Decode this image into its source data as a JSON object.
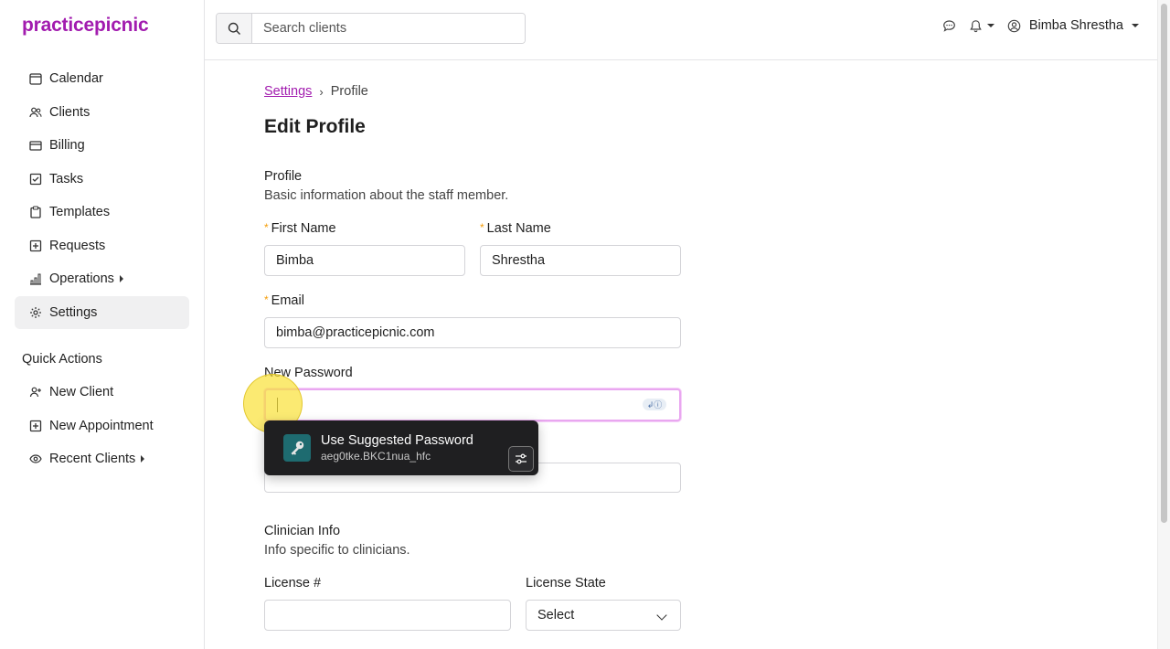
{
  "app": {
    "brand": "practicepicnic"
  },
  "sidebar": {
    "items": [
      {
        "label": "Calendar",
        "icon": "calendar-icon"
      },
      {
        "label": "Clients",
        "icon": "users-icon"
      },
      {
        "label": "Billing",
        "icon": "credit-card-icon"
      },
      {
        "label": "Tasks",
        "icon": "checkbox-icon"
      },
      {
        "label": "Templates",
        "icon": "clipboard-icon"
      },
      {
        "label": "Requests",
        "icon": "plus-square-icon"
      },
      {
        "label": "Operations",
        "icon": "bar-chart-icon"
      },
      {
        "label": "Settings",
        "icon": "gear-icon"
      }
    ],
    "active": "Settings",
    "quick_actions_title": "Quick Actions",
    "quick_actions": [
      {
        "label": "New Client",
        "icon": "user-plus-icon"
      },
      {
        "label": "New Appointment",
        "icon": "plus-square-icon"
      },
      {
        "label": "Recent Clients",
        "icon": "eye-icon"
      }
    ]
  },
  "topbar": {
    "search_placeholder": "Search clients",
    "user_name": "Bimba Shrestha"
  },
  "breadcrumb": {
    "parent": "Settings",
    "current": "Profile"
  },
  "page_title": "Edit Profile",
  "profile": {
    "title": "Profile",
    "description": "Basic information about the staff member.",
    "first_name_label": "First Name",
    "first_name_value": "Bimba",
    "last_name_label": "Last Name",
    "last_name_value": "Shrestha",
    "email_label": "Email",
    "email_value": "bimba@practicepicnic.com",
    "new_password_label": "New Password",
    "new_password_value": "",
    "confirm_password_value": ""
  },
  "password_suggestion": {
    "title": "Use Suggested Password",
    "password": "aeg0tke.BKC1nua_hfc"
  },
  "clinician": {
    "title": "Clinician Info",
    "description": "Info specific to clinicians.",
    "license_label": "License #",
    "license_value": "",
    "license_state_label": "License State",
    "license_state_value": "Select"
  },
  "colors": {
    "brand": "#a21caf",
    "required": "#f59e0b",
    "focus_ring": "#e9a7f0"
  }
}
